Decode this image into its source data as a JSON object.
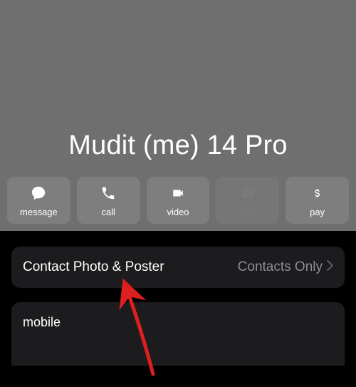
{
  "contact": {
    "name": "Mudit (me) 14 Pro"
  },
  "actions": {
    "message": {
      "label": "message"
    },
    "call": {
      "label": "call"
    },
    "video": {
      "label": "video"
    },
    "mail": {
      "label": "mail"
    },
    "pay": {
      "label": "pay"
    }
  },
  "rows": {
    "photo_poster": {
      "label": "Contact Photo & Poster",
      "value": "Contacts Only"
    },
    "mobile": {
      "label": "mobile"
    }
  }
}
